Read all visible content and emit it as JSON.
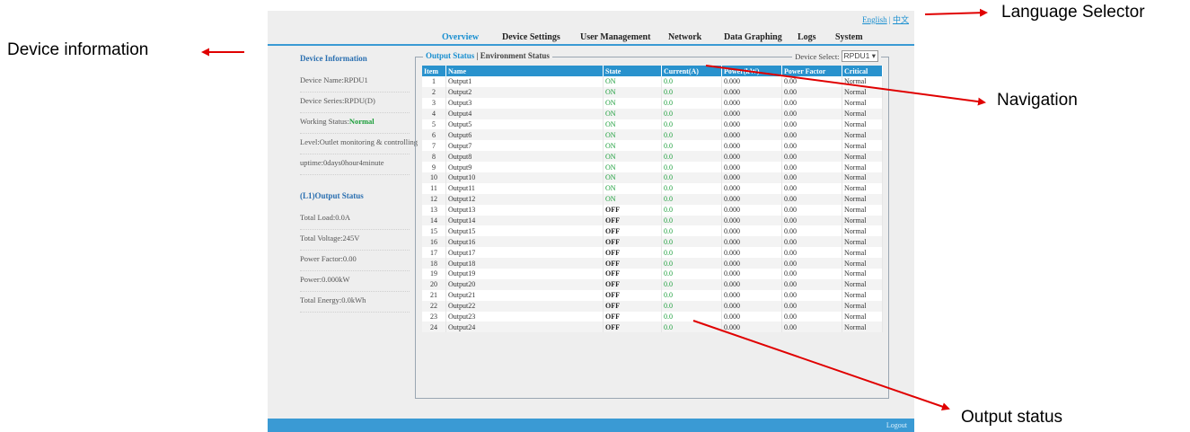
{
  "lang": {
    "english": "English",
    "chinese": "中文"
  },
  "nav": [
    "Overview",
    "Device Settings",
    "User Management",
    "Network",
    "Data Graphing",
    "Logs",
    "System"
  ],
  "sidebar": {
    "device_info_title": "Device Information",
    "device_name": "Device Name:RPDU1",
    "device_series": "Device Series:RPDU(D)",
    "working_status_label": "Working Status:",
    "working_status_value": "Normal",
    "level": "Level:Outlet monitoring & controlling",
    "uptime": "uptime:0days0hour4minute",
    "output_status_title": "(L1)Output Status",
    "total_load": "Total Load:0.0A",
    "total_voltage": "Total Voltage:245V",
    "power_factor": "Power Factor:0.00",
    "power": "Power:0.000kW",
    "total_energy": "Total Energy:0.0kWh"
  },
  "panel": {
    "tab_output": "Output Status",
    "separator": " | ",
    "tab_env": "Environment Status",
    "device_select_label": "Device Select:",
    "device_select_value": "RPDU1 ▾"
  },
  "table": {
    "headers": [
      "Item",
      "Name",
      "State",
      "Current(A)",
      "Power(kW)",
      "Power Factor",
      "Critical"
    ],
    "rows": [
      [
        "1",
        "Output1",
        "ON",
        "0.0",
        "0.000",
        "0.00",
        "Normal"
      ],
      [
        "2",
        "Output2",
        "ON",
        "0.0",
        "0.000",
        "0.00",
        "Normal"
      ],
      [
        "3",
        "Output3",
        "ON",
        "0.0",
        "0.000",
        "0.00",
        "Normal"
      ],
      [
        "4",
        "Output4",
        "ON",
        "0.0",
        "0.000",
        "0.00",
        "Normal"
      ],
      [
        "5",
        "Output5",
        "ON",
        "0.0",
        "0.000",
        "0.00",
        "Normal"
      ],
      [
        "6",
        "Output6",
        "ON",
        "0.0",
        "0.000",
        "0.00",
        "Normal"
      ],
      [
        "7",
        "Output7",
        "ON",
        "0.0",
        "0.000",
        "0.00",
        "Normal"
      ],
      [
        "8",
        "Output8",
        "ON",
        "0.0",
        "0.000",
        "0.00",
        "Normal"
      ],
      [
        "9",
        "Output9",
        "ON",
        "0.0",
        "0.000",
        "0.00",
        "Normal"
      ],
      [
        "10",
        "Output10",
        "ON",
        "0.0",
        "0.000",
        "0.00",
        "Normal"
      ],
      [
        "11",
        "Output11",
        "ON",
        "0.0",
        "0.000",
        "0.00",
        "Normal"
      ],
      [
        "12",
        "Output12",
        "ON",
        "0.0",
        "0.000",
        "0.00",
        "Normal"
      ],
      [
        "13",
        "Output13",
        "OFF",
        "0.0",
        "0.000",
        "0.00",
        "Normal"
      ],
      [
        "14",
        "Output14",
        "OFF",
        "0.0",
        "0.000",
        "0.00",
        "Normal"
      ],
      [
        "15",
        "Output15",
        "OFF",
        "0.0",
        "0.000",
        "0.00",
        "Normal"
      ],
      [
        "16",
        "Output16",
        "OFF",
        "0.0",
        "0.000",
        "0.00",
        "Normal"
      ],
      [
        "17",
        "Output17",
        "OFF",
        "0.0",
        "0.000",
        "0.00",
        "Normal"
      ],
      [
        "18",
        "Output18",
        "OFF",
        "0.0",
        "0.000",
        "0.00",
        "Normal"
      ],
      [
        "19",
        "Output19",
        "OFF",
        "0.0",
        "0.000",
        "0.00",
        "Normal"
      ],
      [
        "20",
        "Output20",
        "OFF",
        "0.0",
        "0.000",
        "0.00",
        "Normal"
      ],
      [
        "21",
        "Output21",
        "OFF",
        "0.0",
        "0.000",
        "0.00",
        "Normal"
      ],
      [
        "22",
        "Output22",
        "OFF",
        "0.0",
        "0.000",
        "0.00",
        "Normal"
      ],
      [
        "23",
        "Output23",
        "OFF",
        "0.0",
        "0.000",
        "0.00",
        "Normal"
      ],
      [
        "24",
        "Output24",
        "OFF",
        "0.0",
        "0.000",
        "0.00",
        "Normal"
      ]
    ]
  },
  "footer": {
    "logout": "Logout"
  },
  "annotations": {
    "device_information": "Device information",
    "language_selector": "Language Selector",
    "navigation": "Navigation",
    "output_status": "Output status"
  },
  "colors": {
    "accent": "#2992cd",
    "on": "#1b9e3a",
    "arrow": "#e00000"
  }
}
